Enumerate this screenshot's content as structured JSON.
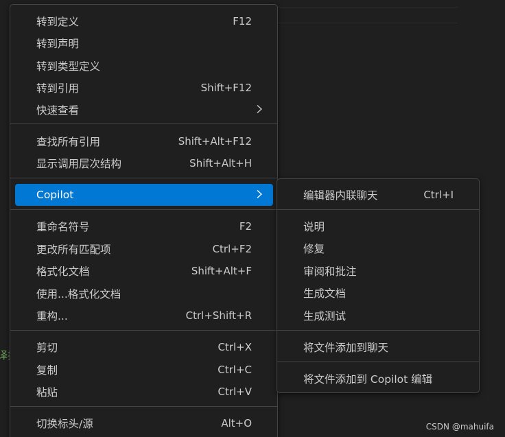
{
  "background_color": "#1f1f1f",
  "accent_color": "#0078d4",
  "editor": {
    "code_fragment": "译指"
  },
  "context_menu": {
    "items": [
      {
        "label": "转到定义",
        "shortcut": "F12"
      },
      {
        "label": "转到声明",
        "shortcut": ""
      },
      {
        "label": "转到类型定义",
        "shortcut": ""
      },
      {
        "label": "转到引用",
        "shortcut": "Shift+F12"
      },
      {
        "label": "快速查看",
        "shortcut": "",
        "submenu_icon": "chevron-right-icon"
      },
      {
        "label": "查找所有引用",
        "shortcut": "Shift+Alt+F12"
      },
      {
        "label": "显示调用层次结构",
        "shortcut": "Shift+Alt+H"
      },
      {
        "label": "Copilot",
        "shortcut": "",
        "submenu_icon": "chevron-right-icon",
        "selected": true
      },
      {
        "label": "重命名符号",
        "shortcut": "F2"
      },
      {
        "label": "更改所有匹配项",
        "shortcut": "Ctrl+F2"
      },
      {
        "label": "格式化文档",
        "shortcut": "Shift+Alt+F"
      },
      {
        "label": "使用...格式化文档",
        "shortcut": ""
      },
      {
        "label": "重构...",
        "shortcut": "Ctrl+Shift+R"
      },
      {
        "label": "剪切",
        "shortcut": "Ctrl+X"
      },
      {
        "label": "复制",
        "shortcut": "Ctrl+C"
      },
      {
        "label": "粘贴",
        "shortcut": "Ctrl+V"
      },
      {
        "label": "切换标头/源",
        "shortcut": "Alt+O"
      }
    ]
  },
  "copilot_submenu": {
    "items": [
      {
        "label": "编辑器内联聊天",
        "shortcut": "Ctrl+I"
      },
      {
        "label": "说明",
        "shortcut": ""
      },
      {
        "label": "修复",
        "shortcut": ""
      },
      {
        "label": "审阅和批注",
        "shortcut": ""
      },
      {
        "label": "生成文档",
        "shortcut": ""
      },
      {
        "label": "生成测试",
        "shortcut": ""
      },
      {
        "label": "将文件添加到聊天",
        "shortcut": ""
      },
      {
        "label": "将文件添加到 Copilot 编辑",
        "shortcut": ""
      }
    ]
  },
  "watermark": "CSDN @mahuifa"
}
